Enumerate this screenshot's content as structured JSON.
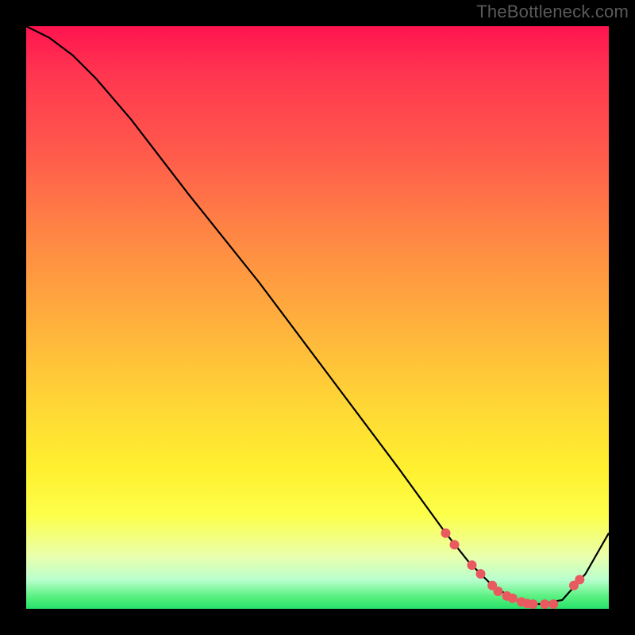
{
  "watermark": "TheBottleneck.com",
  "chart_data": {
    "type": "line",
    "title": "",
    "xlabel": "",
    "ylabel": "",
    "xlim": [
      0,
      100
    ],
    "ylim": [
      0,
      100
    ],
    "series": [
      {
        "name": "curve",
        "x": [
          0,
          4,
          8,
          12,
          18,
          28,
          40,
          52,
          64,
          72,
          76,
          80,
          84,
          88,
          92,
          96,
          100
        ],
        "y": [
          100,
          98,
          95,
          91,
          84,
          71,
          56,
          40,
          24,
          13,
          8,
          4,
          1.5,
          0.8,
          1.5,
          6,
          13
        ]
      }
    ],
    "markers": {
      "name": "highlight-points",
      "color": "#e85a5f",
      "x": [
        72,
        73.5,
        76.5,
        78,
        80,
        81,
        82.5,
        83.5,
        85,
        86,
        87,
        89,
        90.5,
        94,
        95
      ],
      "y": [
        13,
        11,
        7.5,
        6,
        4,
        3,
        2.2,
        1.8,
        1.2,
        0.9,
        0.8,
        0.8,
        0.8,
        4,
        5
      ]
    },
    "background_gradient": {
      "stops": [
        {
          "pos": 0,
          "color": "#ff1450"
        },
        {
          "pos": 8,
          "color": "#ff3550"
        },
        {
          "pos": 22,
          "color": "#ff5b4b"
        },
        {
          "pos": 36,
          "color": "#ff8744"
        },
        {
          "pos": 50,
          "color": "#ffae3d"
        },
        {
          "pos": 64,
          "color": "#ffd436"
        },
        {
          "pos": 76,
          "color": "#fff02f"
        },
        {
          "pos": 84,
          "color": "#fcff4a"
        },
        {
          "pos": 91,
          "color": "#eaffad"
        },
        {
          "pos": 95,
          "color": "#b9ffce"
        },
        {
          "pos": 98,
          "color": "#57f07e"
        },
        {
          "pos": 100,
          "color": "#26e26a"
        }
      ]
    }
  }
}
